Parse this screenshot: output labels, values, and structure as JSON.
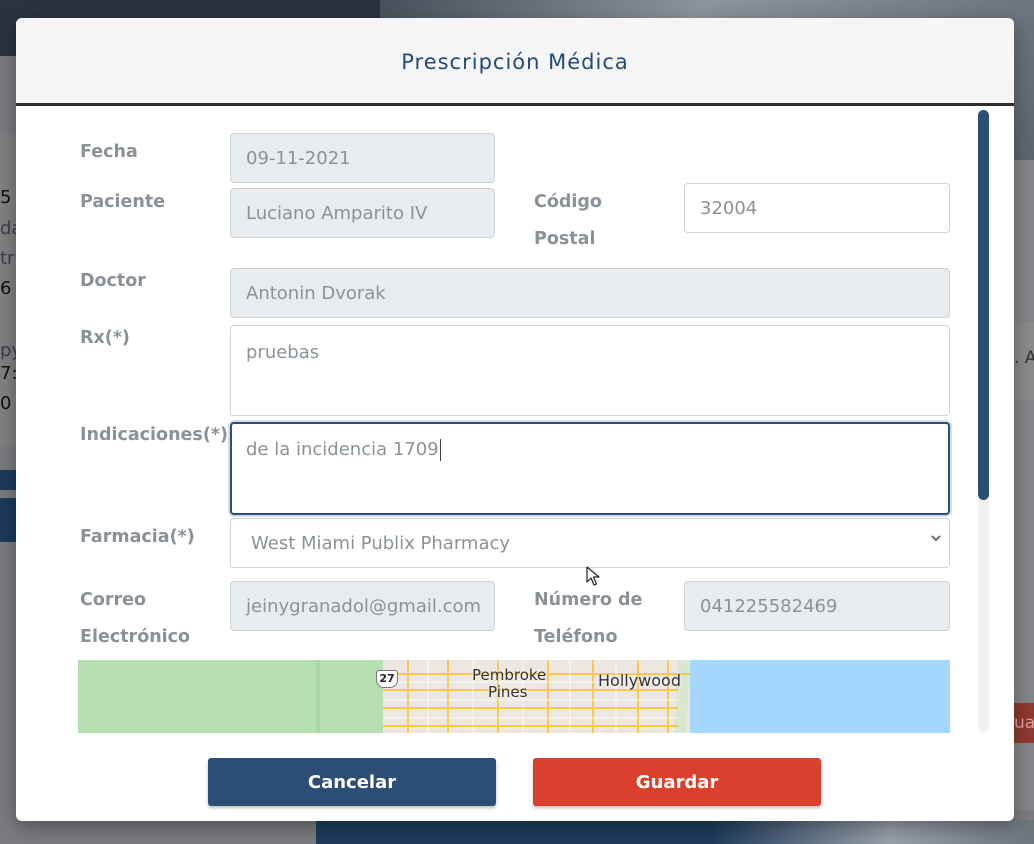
{
  "background": {
    "left_lines": [
      "5",
      "da",
      "tr",
      "6",
      "py",
      "7:",
      "0"
    ],
    "right_fragment": ". A",
    "right_button_fragment": "ua"
  },
  "modal": {
    "title": "Prescripción Médica",
    "fields": {
      "fecha": {
        "label": "Fecha",
        "value": "09-11-2021"
      },
      "paciente": {
        "label": "Paciente",
        "value": "Luciano Amparito IV"
      },
      "codigo_postal": {
        "label_line1": "Código",
        "label_line2": "Postal",
        "value": "32004"
      },
      "doctor": {
        "label": "Doctor",
        "value": "Antonin Dvorak"
      },
      "rx": {
        "label": "Rx(*)",
        "value": "pruebas"
      },
      "indicaciones": {
        "label": "Indicaciones(*)",
        "value": "de la incidencia 1709"
      },
      "farmacia": {
        "label": "Farmacia(*)",
        "value": "West Miami Publix Pharmacy"
      },
      "correo": {
        "label_line1": "Correo",
        "label_line2": "Electrónico",
        "value": "jeinygranadol@gmail.com"
      },
      "telefono": {
        "label_line1": "Número de",
        "label_line2": "Teléfono",
        "value": "041225582469"
      }
    },
    "map": {
      "labels": [
        "Pembroke",
        "Pines",
        "Hollywood"
      ],
      "route_shield": "27",
      "colors": {
        "land": "#b5dfb0",
        "water": "#a5d6fd",
        "urban": "#ece7e0",
        "roads": "#f6c94a"
      }
    },
    "buttons": {
      "cancel": "Cancelar",
      "save": "Guardar"
    }
  },
  "colors": {
    "title": "#234b76",
    "cancel_button": "#2c4e74",
    "save_button": "#d9412e",
    "label": "#8a9298"
  }
}
